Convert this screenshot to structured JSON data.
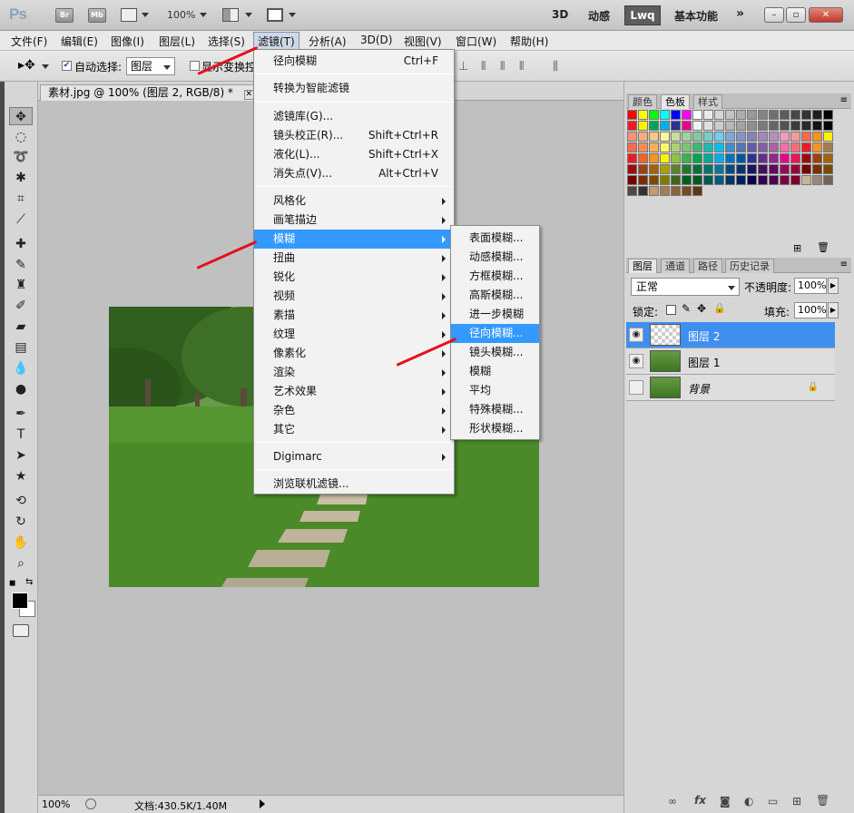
{
  "appbar": {
    "logo": "Ps",
    "bridge": "Br",
    "minibridge": "Mb",
    "zoom": "100%",
    "workspaces": [
      "3D",
      "动感",
      "Lwq",
      "基本功能"
    ],
    "active_workspace": "Lwq"
  },
  "menubar": {
    "items": [
      "文件(F)",
      "编辑(E)",
      "图像(I)",
      "图层(L)",
      "选择(S)",
      "滤镜(T)",
      "分析(A)",
      "3D(D)",
      "视图(V)",
      "窗口(W)",
      "帮助(H)"
    ],
    "active": "滤镜(T)"
  },
  "optbar": {
    "auto_select_label": "自动选择:",
    "auto_select_checked": true,
    "auto_select_value": "图层",
    "show_transform_label": "显示变换控件"
  },
  "document": {
    "tab_title": "素材.jpg @ 100% (图层 2, RGB/8) *",
    "status_zoom": "100%",
    "status_doc": "文档:430.5K/1.40M"
  },
  "filter_menu": {
    "items": [
      {
        "label": "径向模糊",
        "shortcut": "Ctrl+F"
      },
      {
        "label": "转换为智能滤镜"
      },
      {
        "label": "滤镜库(G)..."
      },
      {
        "label": "镜头校正(R)...",
        "shortcut": "Shift+Ctrl+R"
      },
      {
        "label": "液化(L)...",
        "shortcut": "Shift+Ctrl+X"
      },
      {
        "label": "消失点(V)...",
        "shortcut": "Alt+Ctrl+V"
      },
      {
        "label": "风格化",
        "submenu": true
      },
      {
        "label": "画笔描边",
        "submenu": true
      },
      {
        "label": "模糊",
        "submenu": true,
        "highlighted": true
      },
      {
        "label": "扭曲",
        "submenu": true
      },
      {
        "label": "锐化",
        "submenu": true
      },
      {
        "label": "视频",
        "submenu": true
      },
      {
        "label": "素描",
        "submenu": true
      },
      {
        "label": "纹理",
        "submenu": true
      },
      {
        "label": "像素化",
        "submenu": true
      },
      {
        "label": "渲染",
        "submenu": true
      },
      {
        "label": "艺术效果",
        "submenu": true
      },
      {
        "label": "杂色",
        "submenu": true
      },
      {
        "label": "其它",
        "submenu": true
      },
      {
        "label": "Digimarc",
        "submenu": true
      },
      {
        "label": "浏览联机滤镜..."
      }
    ]
  },
  "blur_submenu": {
    "items": [
      {
        "label": "表面模糊..."
      },
      {
        "label": "动感模糊..."
      },
      {
        "label": "方框模糊..."
      },
      {
        "label": "高斯模糊..."
      },
      {
        "label": "进一步模糊"
      },
      {
        "label": "径向模糊...",
        "highlighted": true
      },
      {
        "label": "镜头模糊..."
      },
      {
        "label": "模糊"
      },
      {
        "label": "平均"
      },
      {
        "label": "特殊模糊..."
      },
      {
        "label": "形状模糊..."
      }
    ]
  },
  "swatches_panel": {
    "tabs": [
      "颜色",
      "色板",
      "样式"
    ],
    "active_tab": "色板"
  },
  "layers_panel": {
    "tabs": [
      "图层",
      "通道",
      "路径",
      "历史记录"
    ],
    "active_tab": "图层",
    "blend_mode": "正常",
    "opacity_label": "不透明度:",
    "opacity": "100%",
    "lock_label": "锁定:",
    "fill_label": "填充:",
    "fill": "100%",
    "layers": [
      {
        "name": "图层 2",
        "selected": true,
        "visible": true
      },
      {
        "name": "图层 1",
        "selected": false,
        "visible": true
      },
      {
        "name": "背景",
        "selected": false,
        "visible": false,
        "locked": true
      }
    ]
  }
}
